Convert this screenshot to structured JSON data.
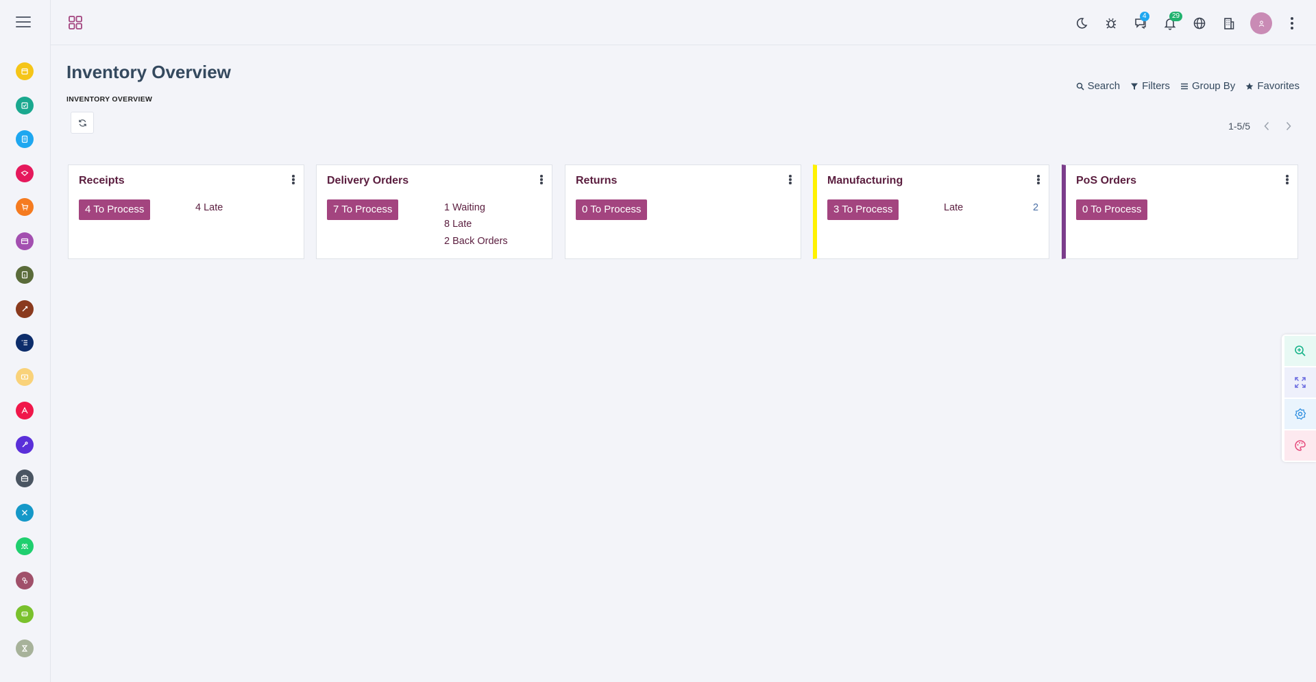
{
  "sidebar": {
    "apps": [
      {
        "name": "app-calendar",
        "color": "#f5c518"
      },
      {
        "name": "app-todo",
        "color": "#1aa88f"
      },
      {
        "name": "app-notes",
        "color": "#1ea7f0"
      },
      {
        "name": "app-crm",
        "color": "#e5195c"
      },
      {
        "name": "app-sales",
        "color": "#f57b20"
      },
      {
        "name": "app-invoicing",
        "color": "#a34fb0"
      },
      {
        "name": "app-accounting",
        "color": "#5a6b3a"
      },
      {
        "name": "app-project",
        "color": "#8a3a1e"
      },
      {
        "name": "app-timesheet",
        "color": "#0d2d6b"
      },
      {
        "name": "app-expenses",
        "color": "#f9d27a"
      },
      {
        "name": "app-website",
        "color": "#f0174a"
      },
      {
        "name": "app-tools",
        "color": "#5a2fd9"
      },
      {
        "name": "app-inventory",
        "color": "#4a5562"
      },
      {
        "name": "app-manufacturing",
        "color": "#1598c8"
      },
      {
        "name": "app-employees",
        "color": "#1fcf6f"
      },
      {
        "name": "app-recruitment",
        "color": "#a0506a"
      },
      {
        "name": "app-fleet",
        "color": "#7ac12d"
      },
      {
        "name": "app-time-off",
        "color": "#a7b29a"
      }
    ]
  },
  "topbar": {
    "chat_badge": "4",
    "notif_badge": "29",
    "chat_badge_color": "#1ea7f0",
    "notif_badge_color": "#21b26f"
  },
  "header": {
    "title": "Inventory Overview",
    "breadcrumb": "INVENTORY OVERVIEW"
  },
  "searchbar": {
    "search": "Search",
    "filters": "Filters",
    "group_by": "Group By",
    "favorites": "Favorites"
  },
  "pager": {
    "range": "1-5/5"
  },
  "cards": [
    {
      "title": "Receipts",
      "process": "4 To Process",
      "stats": [
        "4 Late"
      ],
      "accent": ""
    },
    {
      "title": "Delivery Orders",
      "process": "7 To Process",
      "stats": [
        "1 Waiting",
        "8 Late",
        "2 Back Orders"
      ],
      "accent": ""
    },
    {
      "title": "Returns",
      "process": "0 To Process",
      "stats": [],
      "accent": ""
    },
    {
      "title": "Manufacturing",
      "process": "3 To Process",
      "stats": [
        "Late"
      ],
      "num": "2",
      "accent": "#fff200"
    },
    {
      "title": "PoS Orders",
      "process": "0 To Process",
      "stats": [],
      "accent": "#7b3d8b"
    }
  ],
  "colors": {
    "primary": "#a3447f",
    "card_title": "#5a1d3e"
  }
}
